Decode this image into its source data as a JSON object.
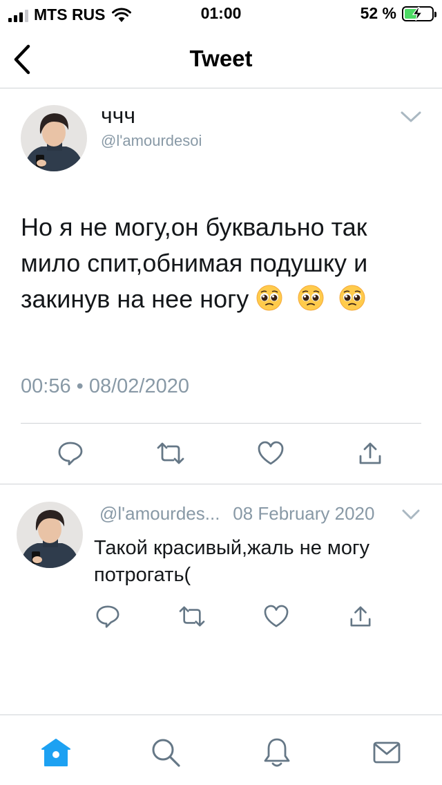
{
  "status_bar": {
    "carrier": "MTS RUS",
    "time": "01:00",
    "battery_percent": "52 %",
    "battery_level": 0.52,
    "signal_bars_active": 3
  },
  "nav": {
    "title": "Tweet",
    "back_icon": "chevron-left-icon"
  },
  "tweet": {
    "display_name": "ччч",
    "handle": "@l'amourdesoi",
    "text": "Но я не могу,он буквально так мило спит,обнимая подушку и закинув на нее ногу",
    "emoji": "pleading-face-emoji",
    "emoji_count": 3,
    "timestamp": "00:56 • 08/02/2020",
    "menu_icon": "chevron-down-icon",
    "actions": [
      "reply-icon",
      "retweet-icon",
      "like-icon",
      "share-icon"
    ]
  },
  "reply": {
    "handle": "@l'amourdes...",
    "date": "08 February 2020",
    "text": "Такой красивый,жаль не могу потрогать(",
    "actions": [
      "reply-icon",
      "retweet-icon",
      "like-icon",
      "share-icon"
    ]
  },
  "tabbar": {
    "tabs": [
      "home-icon",
      "search-icon",
      "notifications-icon",
      "messages-icon"
    ],
    "active": "home-icon"
  },
  "colors": {
    "accent": "#1da1f2",
    "secondary_text": "#8899a6",
    "icon_gray": "#657786",
    "divider": "#cfd3d6",
    "battery_fill": "#4cd964"
  }
}
